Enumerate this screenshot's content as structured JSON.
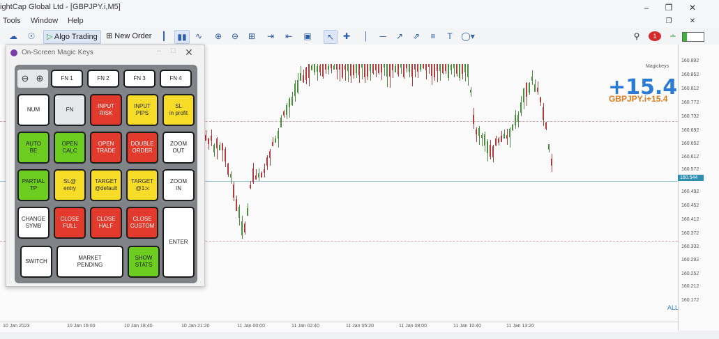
{
  "window": {
    "title": "ightCap Global Ltd - [GBPJPY.i,M5]"
  },
  "menu": [
    "Tools",
    "Window",
    "Help"
  ],
  "toolbar": {
    "algo_trading": "Algo Trading",
    "new_order": "New Order"
  },
  "chart": {
    "symbol": "GBPJPY.i",
    "profit_big": "+15.4",
    "profit_small": "GBPJPY.i+15.4",
    "magickeys_label": "Magickeys",
    "all_label": "ALL",
    "current_price": "160.544",
    "price_labels": [
      "160.892",
      "160.852",
      "160.812",
      "160.772",
      "160.732",
      "160.692",
      "160.652",
      "160.612",
      "160.572",
      "160.532",
      "160.492",
      "160.452",
      "160.412",
      "160.372",
      "160.332",
      "160.292",
      "160.252",
      "160.212",
      "160.172"
    ],
    "time_labels": [
      "10 Jan 2023",
      "10 Jan 16:00",
      "10 Jan 18:40",
      "10 Jan 21:20",
      "11 Jan 00:00",
      "11 Jan 02:40",
      "11 Jan 05:20",
      "11 Jan 08:00",
      "11 Jan 10:40",
      "11 Jan 13:20"
    ]
  },
  "panel": {
    "title": "On-Screen Magic Keys",
    "keys": {
      "fn1": "FN 1",
      "fn2": "FN 2",
      "fn3": "FN 3",
      "fn4": "FN 4",
      "num": "NUM",
      "fn": "FN",
      "input_risk": "INPUT\nRISK",
      "input_pips": "INPUT\nPIPS",
      "sl_in_profit": "SL\nin profit",
      "auto_be": "AUTO\nBE",
      "open_calc": "OPEN\nCALC",
      "open_trade": "OPEN\nTRADE",
      "double_order": "DOUBLE\nORDER",
      "zoom_out": "ZOOM\nOUT",
      "partial_tp": "PARTIAL\nTP",
      "sl_entry": "SL@\nentry",
      "target_default": "TARGET\n@default",
      "target_1x": "TARGET\n@1:x",
      "zoom_in": "ZOOM\nIN",
      "change_symb": "CHANGE\nSYMB",
      "close_full": "CLOSE\nFULL",
      "close_half": "CLOSE\nHALF",
      "close_custom": "CLOSE\nCUSTOM",
      "enter": "ENTER",
      "switch": "SWITCH",
      "market_pending": "MARKET\nPENDING",
      "show_stats": "SHOW\nSTATS"
    }
  },
  "colors": {
    "red": "#e23a2c",
    "green": "#6dcc20",
    "yellow": "#f6dc27",
    "profit_blue": "#2a7bd6",
    "profit_orange": "#e07b1b"
  }
}
